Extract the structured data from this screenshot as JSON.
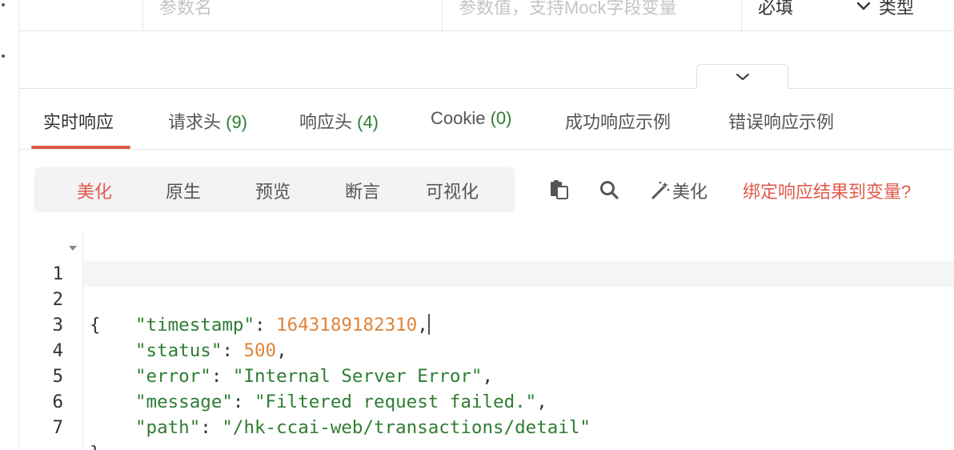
{
  "param_row": {
    "name_placeholder": "参数名",
    "value_placeholder": "参数值，支持Mock字段变量",
    "required_value": "必填",
    "type_label": "类型"
  },
  "tabs": [
    {
      "label": "实时响应",
      "count": ""
    },
    {
      "label": "请求头 ",
      "count": "(9)"
    },
    {
      "label": "响应头 ",
      "count": "(4)"
    },
    {
      "label": "Cookie ",
      "count": "(0)"
    },
    {
      "label": "成功响应示例",
      "count": ""
    },
    {
      "label": "错误响应示例",
      "count": ""
    }
  ],
  "active_tab": 0,
  "view_modes": [
    "美化",
    "原生",
    "预览",
    "断言",
    "可视化"
  ],
  "active_view_mode": 0,
  "toolbar": {
    "copy_icon": "copy-icon",
    "search_icon": "search-icon",
    "beautify_icon": "magic-wand-icon",
    "beautify_label": "美化",
    "bind_link": "绑定响应结果到变量?"
  },
  "code": {
    "lines": [
      {
        "num": "1",
        "open": "{"
      },
      {
        "num": "2",
        "key": "\"timestamp\"",
        "value": "1643189182310",
        "value_kind": "number",
        "trail": ","
      },
      {
        "num": "3",
        "key": "\"status\"",
        "value": "500",
        "value_kind": "number",
        "trail": ","
      },
      {
        "num": "4",
        "key": "\"error\"",
        "value": "\"Internal Server Error\"",
        "value_kind": "string",
        "trail": ","
      },
      {
        "num": "5",
        "key": "\"message\"",
        "value": "\"Filtered request failed.\"",
        "value_kind": "string",
        "trail": ","
      },
      {
        "num": "6",
        "key": "\"path\"",
        "value": "\"/hk-ccai-web/transactions/detail\"",
        "value_kind": "string",
        "trail": ""
      },
      {
        "num": "7",
        "close": "}"
      }
    ]
  },
  "colors": {
    "accent": "#e05a4b",
    "string": "#2e7d32",
    "number": "#e0843a"
  }
}
